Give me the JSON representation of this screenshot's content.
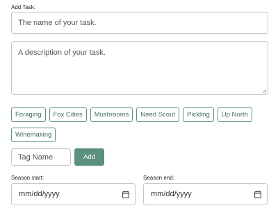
{
  "task": {
    "add_task_label": "Add Task:",
    "name_placeholder": "The name of your task.",
    "description_placeholder": "A description of your task."
  },
  "tags": [
    "Foraging",
    "Fox Cities",
    "Mushrooms",
    "Need Scout",
    "Pickling",
    "Up North",
    "Winemaking"
  ],
  "new_tag": {
    "placeholder": "Tag Name",
    "add_label": "Add"
  },
  "season": {
    "start_label": "Season start:",
    "start_value": "mm/dd/yyyy",
    "end_label": "Season end:",
    "end_value": "mm/dd/yyyy",
    "icon": "calendar-icon"
  },
  "colors": {
    "accent": "#5b8f7e",
    "tag_border": "#5f8f7f",
    "tag_text": "#3f6e5e",
    "input_border": "#bfc5cc"
  }
}
